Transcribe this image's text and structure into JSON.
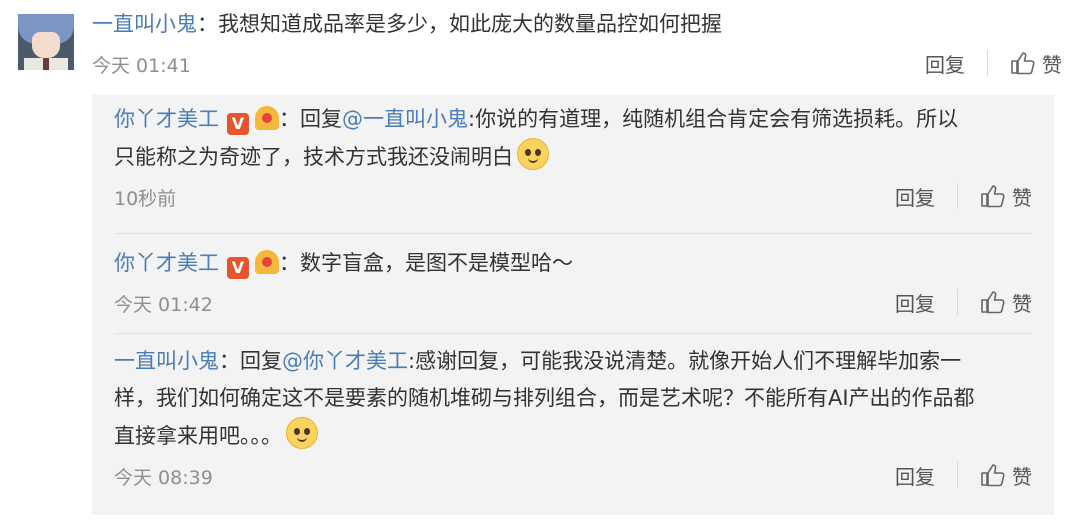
{
  "main": {
    "user": "一直叫小鬼",
    "colon": "：",
    "text": "我想知道成品率是多少，如此庞大的数量品控如何把握",
    "time": "今天 01:41",
    "reply_label": "回复",
    "like_label": "赞",
    "avatar_icon": "anime-avatar"
  },
  "replies": [
    {
      "user": "你丫才美工",
      "colon": "：",
      "reply_prefix": "回复",
      "reply_to": "@一直叫小鬼",
      "lines": [
        "你说的有道理，纯随机组合肯定会有筛选损耗。所以",
        "只能称之为奇迹了，技术方式我还没闹明白"
      ],
      "text_prefix": ":",
      "time": "10秒前",
      "reply_label": "回复",
      "like_label": "赞",
      "badges": [
        "verified-v-icon",
        "medal-icon"
      ],
      "emoji": "pleading-emoji"
    },
    {
      "user": "你丫才美工",
      "colon": "：",
      "text": "数字盲盒，是图不是模型哈～",
      "time": "今天 01:42",
      "reply_label": "回复",
      "like_label": "赞",
      "badges": [
        "verified-v-icon",
        "medal-icon"
      ]
    },
    {
      "user": "一直叫小鬼",
      "colon": "：",
      "reply_prefix": "回复",
      "reply_to": "@你丫才美工",
      "lines": [
        "感谢回复，可能我没说清楚。就像开始人们不理解毕加索一",
        "样，我们如何确定这不是要素的随机堆砌与排列组合，而是艺术呢？不能所有AI产出的作品都",
        "直接拿来用吧。。。"
      ],
      "text_prefix": ":",
      "time": "今天 08:39",
      "reply_label": "回复",
      "like_label": "赞",
      "emoji": "thinking-emoji"
    }
  ],
  "badge_v_text": "V",
  "colors": {
    "link": "#4a7db5",
    "text": "#333333",
    "meta": "#8f8f8f",
    "reply_bg": "#f3f3f3"
  }
}
